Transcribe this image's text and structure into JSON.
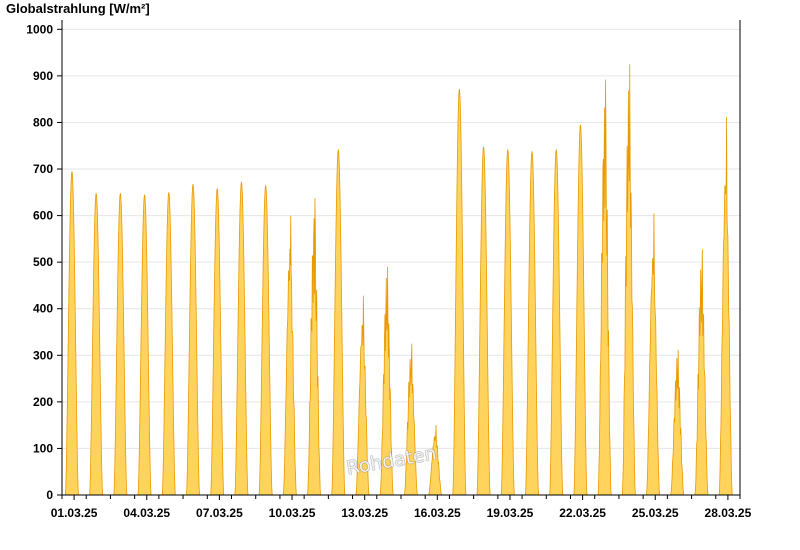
{
  "chart_data": {
    "type": "area",
    "title": "Globalstrahlung [W/m²]",
    "xlabel": "",
    "ylabel": "",
    "ylim": [
      0,
      1020
    ],
    "xlim": [
      "01.03.25",
      "29.03.25"
    ],
    "y_ticks": [
      0,
      100,
      200,
      300,
      400,
      500,
      600,
      700,
      800,
      900,
      1000
    ],
    "x_tick_labels": [
      "01.03.25",
      "04.03.25",
      "07.03.25",
      "10.03.25",
      "13.03.25",
      "16.03.25",
      "19.03.25",
      "22.03.25",
      "25.03.25",
      "28.03.25"
    ],
    "grid": true,
    "colors": {
      "fill": "#ffd35c",
      "stroke": "#e89a00",
      "grid": "#e6e6e6",
      "axis": "#000000"
    },
    "series": [
      {
        "dates": [
          "01.03.25",
          "02.03.25",
          "03.03.25",
          "04.03.25",
          "05.03.25",
          "06.03.25",
          "07.03.25",
          "08.03.25",
          "09.03.25",
          "10.03.25",
          "11.03.25",
          "12.03.25",
          "13.03.25",
          "14.03.25",
          "15.03.25",
          "16.03.25",
          "17.03.25",
          "18.03.25",
          "19.03.25",
          "20.03.25",
          "21.03.25",
          "22.03.25",
          "23.03.25",
          "24.03.25",
          "25.03.25",
          "26.03.25",
          "27.03.25",
          "28.03.25"
        ],
        "daily_peak": [
          695,
          648,
          648,
          645,
          650,
          668,
          658,
          672,
          665,
          600,
          638,
          742,
          428,
          490,
          325,
          150,
          872,
          748,
          742,
          738,
          742,
          795,
          892,
          925,
          605,
          312,
          528,
          812
        ]
      }
    ]
  },
  "watermark": "Rohdaten"
}
